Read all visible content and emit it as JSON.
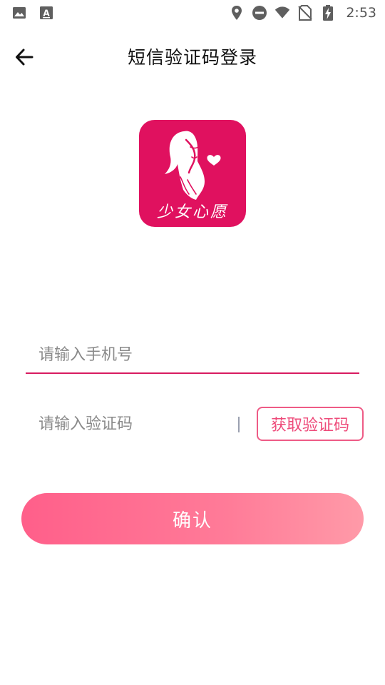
{
  "status_bar": {
    "time": "2:53",
    "icons": [
      "image-icon",
      "a-notification-icon",
      "location-icon",
      "dnd-icon",
      "wifi-icon",
      "no-sim-icon",
      "battery-charging-icon"
    ]
  },
  "header": {
    "title": "短信验证码登录",
    "back_icon": "arrow-left-icon"
  },
  "logo": {
    "text": "少女心愿",
    "background_color": "#e0115f"
  },
  "phone": {
    "placeholder": "请输入手机号",
    "value": ""
  },
  "code": {
    "placeholder": "请输入验证码",
    "value": "",
    "get_code_label": "获取验证码"
  },
  "confirm": {
    "label": "确认"
  },
  "colors": {
    "accent": "#d81b60",
    "button_gradient_start": "#ff5f8a",
    "button_gradient_end": "#ff9aa8",
    "get_code_border": "#ee5b86"
  }
}
